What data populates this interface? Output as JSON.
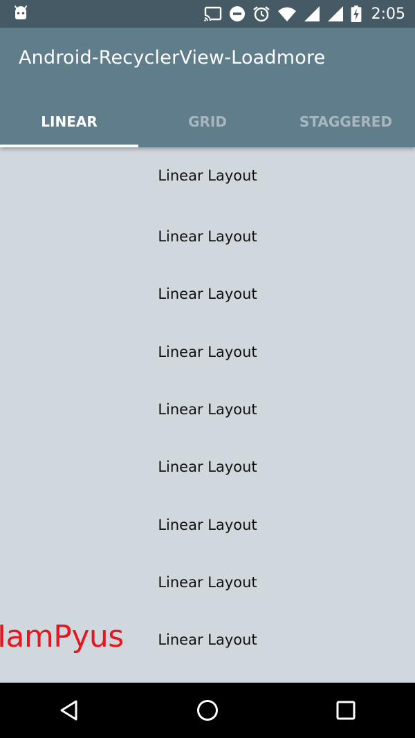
{
  "status_bar": {
    "time": "2:05",
    "icons": [
      "android-icon",
      "cast-icon",
      "do-not-disturb-icon",
      "alarm-icon",
      "wifi-icon",
      "signal-icon",
      "signal-icon",
      "battery-charging-icon"
    ]
  },
  "app_bar": {
    "title": "Android-RecyclerView-Loadmore",
    "background_color": "#607d8b"
  },
  "tabs": [
    {
      "label": "LINEAR",
      "active": true
    },
    {
      "label": "GRID",
      "active": false
    },
    {
      "label": "STAGGERED",
      "active": false
    }
  ],
  "list": {
    "items": [
      "Linear Layout",
      "Linear Layout",
      "Linear Layout",
      "Linear Layout",
      "Linear Layout",
      "Linear Layout",
      "Linear Layout",
      "Linear Layout",
      "Linear Layout"
    ]
  },
  "watermark": {
    "text": "IamPyus",
    "color": "#e8141e"
  },
  "nav_bar": {
    "buttons": [
      "back-icon",
      "home-icon",
      "recents-icon"
    ]
  }
}
